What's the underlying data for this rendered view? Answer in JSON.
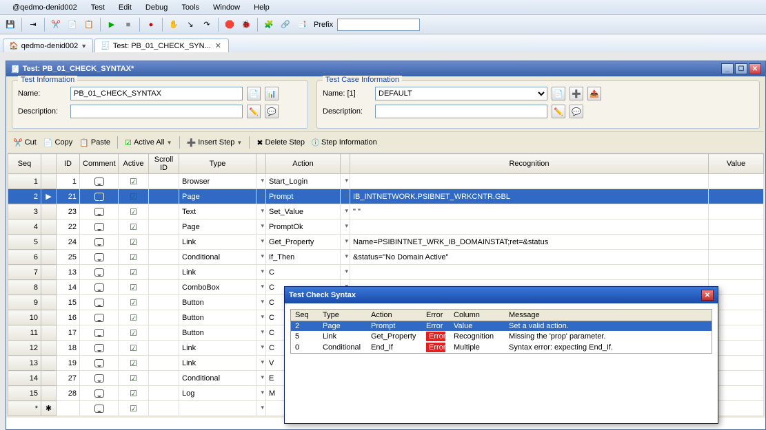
{
  "menubar": {
    "items": [
      "@qedmo-denid002",
      "Test",
      "Edit",
      "Debug",
      "Tools",
      "Window",
      "Help"
    ]
  },
  "toolbar": {
    "prefix_label": "Prefix",
    "prefix_value": "",
    "icons": [
      "save",
      "step-run",
      "cut",
      "copy",
      "paste",
      "play",
      "stop",
      "record",
      "hand",
      "step-into",
      "step-over",
      "stop-sign",
      "bug",
      "tree",
      "link",
      "props"
    ]
  },
  "tabs": [
    {
      "label": "qedmo-denid002",
      "icon": "home",
      "active": false,
      "closable": false,
      "dropdown": true
    },
    {
      "label": "Test: PB_01_CHECK_SYN...",
      "icon": "test",
      "active": true,
      "closable": true,
      "dropdown": false
    }
  ],
  "doc": {
    "title": "Test: PB_01_CHECK_SYNTAX*",
    "test_info": {
      "legend": "Test Information",
      "name_label": "Name:",
      "name_value": "PB_01_CHECK_SYNTAX",
      "desc_label": "Description:",
      "desc_value": ""
    },
    "case_info": {
      "legend": "Test Case Information",
      "name_label": "Name:  [1]",
      "name_value": "DEFAULT",
      "desc_label": "Description:",
      "desc_value": ""
    },
    "actionbar": {
      "cut": "Cut",
      "copy": "Copy",
      "paste": "Paste",
      "active_all": "Active All",
      "insert_step": "Insert Step",
      "delete_step": "Delete Step",
      "step_info": "Step Information"
    },
    "columns": [
      "Seq",
      "",
      "ID",
      "Comment",
      "Active",
      "Scroll ID",
      "Type",
      "",
      "Action",
      "",
      "Recognition",
      "Value"
    ],
    "rows": [
      {
        "seq": "1",
        "mark": "",
        "id": "1",
        "active": true,
        "scroll": "",
        "type": "Browser",
        "action": "Start_Login",
        "recog": ""
      },
      {
        "seq": "2",
        "mark": "arrow",
        "id": "21",
        "active": true,
        "scroll": "",
        "type": "Page",
        "action": "Prompt",
        "recog": "IB_INTNETWORK.PSIBNET_WRKCNTR.GBL",
        "selected": true
      },
      {
        "seq": "3",
        "mark": "",
        "id": "23",
        "active": true,
        "scroll": "",
        "type": "Text",
        "action": "Set_Value",
        "recog": "\" \""
      },
      {
        "seq": "4",
        "mark": "",
        "id": "22",
        "active": true,
        "scroll": "",
        "type": "Page",
        "action": "PromptOk",
        "recog": ""
      },
      {
        "seq": "5",
        "mark": "",
        "id": "24",
        "active": true,
        "scroll": "",
        "type": "Link",
        "action": "Get_Property",
        "recog": "Name=PSIBINTNET_WRK_IB_DOMAINSTAT;ret=&status"
      },
      {
        "seq": "6",
        "mark": "",
        "id": "25",
        "active": true,
        "scroll": "",
        "type": "Conditional",
        "action": "If_Then",
        "recog": "&status=\"No Domain Active\""
      },
      {
        "seq": "7",
        "mark": "",
        "id": "13",
        "active": true,
        "scroll": "",
        "type": "Link",
        "action": "C",
        "recog": ""
      },
      {
        "seq": "8",
        "mark": "",
        "id": "14",
        "active": true,
        "scroll": "",
        "type": "ComboBox",
        "action": "C",
        "recog": ""
      },
      {
        "seq": "9",
        "mark": "",
        "id": "15",
        "active": true,
        "scroll": "",
        "type": "Button",
        "action": "C",
        "recog": ""
      },
      {
        "seq": "10",
        "mark": "",
        "id": "16",
        "active": true,
        "scroll": "",
        "type": "Button",
        "action": "C",
        "recog": ""
      },
      {
        "seq": "11",
        "mark": "",
        "id": "17",
        "active": true,
        "scroll": "",
        "type": "Button",
        "action": "C",
        "recog": ""
      },
      {
        "seq": "12",
        "mark": "",
        "id": "18",
        "active": true,
        "scroll": "",
        "type": "Link",
        "action": "C",
        "recog": ""
      },
      {
        "seq": "13",
        "mark": "",
        "id": "19",
        "active": true,
        "scroll": "",
        "type": "Link",
        "action": "V",
        "recog": ""
      },
      {
        "seq": "14",
        "mark": "",
        "id": "27",
        "active": true,
        "scroll": "",
        "type": "Conditional",
        "action": "E",
        "recog": ""
      },
      {
        "seq": "15",
        "mark": "",
        "id": "28",
        "active": true,
        "scroll": "",
        "type": "Log",
        "action": "M",
        "recog": ""
      },
      {
        "seq": "*",
        "mark": "",
        "id": "",
        "active": true,
        "scroll": "",
        "type": "",
        "action": "",
        "recog": ""
      }
    ]
  },
  "popup": {
    "title": "Test Check Syntax",
    "columns": [
      "Seq",
      "Type",
      "Action",
      "Error",
      "Column",
      "Message"
    ],
    "rows": [
      {
        "seq": "2",
        "type": "Page",
        "action": "Prompt",
        "error": "Error",
        "column": "Value",
        "message": "Set a valid action.",
        "selected": true
      },
      {
        "seq": "5",
        "type": "Link",
        "action": "Get_Property",
        "error": "Error",
        "column": "Recognition",
        "message": "Missing the 'prop' parameter.",
        "errRed": true
      },
      {
        "seq": "0",
        "type": "Conditional",
        "action": "End_If",
        "error": "Error",
        "column": "Multiple",
        "message": "Syntax error: expecting End_If.",
        "errRed": true
      }
    ]
  }
}
